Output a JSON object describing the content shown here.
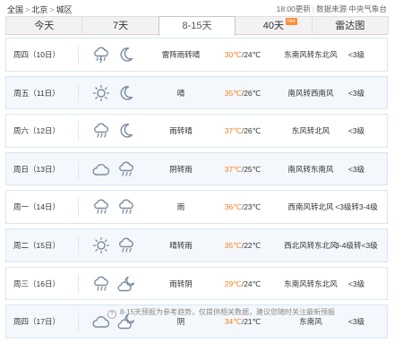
{
  "breadcrumb": [
    "全国",
    "北京",
    "城区"
  ],
  "source": {
    "updated": "18:00更新",
    "label": "数据来源 中央气象台"
  },
  "tabs": [
    {
      "label": "今天",
      "active": false
    },
    {
      "label": "7天",
      "active": false
    },
    {
      "label": "8-15天",
      "active": true
    },
    {
      "label": "40天",
      "active": false,
      "badge": "Hot"
    },
    {
      "label": "雷达图",
      "active": false
    }
  ],
  "rows": [
    {
      "date": "周四（10日）",
      "icons": [
        "thunderstorm-icon",
        "moon-icon"
      ],
      "weather": "雷阵雨转晴",
      "high": "30℃",
      "low": "24℃",
      "wind": "东南风转东北风",
      "level": "<3级"
    },
    {
      "date": "周五（11日）",
      "icons": [
        "sun-icon",
        "moon-icon"
      ],
      "weather": "晴",
      "high": "35℃",
      "low": "26℃",
      "wind": "南风转西南风",
      "level": "<3级"
    },
    {
      "date": "周六（12日）",
      "icons": [
        "rain-icon",
        "moon-icon"
      ],
      "weather": "雨转晴",
      "high": "37℃",
      "low": "26℃",
      "wind": "东风转北风",
      "level": "<3级"
    },
    {
      "date": "周日（13日）",
      "icons": [
        "cloudy-icon",
        "rain-icon"
      ],
      "weather": "阴转雨",
      "high": "37℃",
      "low": "25℃",
      "wind": "南风转东南风",
      "level": "<3级"
    },
    {
      "date": "周一（14日）",
      "icons": [
        "rain-icon",
        "rain-icon"
      ],
      "weather": "雨",
      "high": "36℃",
      "low": "23℃",
      "wind": "西南风转北风",
      "level": "<3级转3-4级"
    },
    {
      "date": "周二（15日）",
      "icons": [
        "sun-icon",
        "rain-icon"
      ],
      "weather": "晴转雨",
      "high": "35℃",
      "low": "22℃",
      "wind": "西北风转东北风",
      "level": "3-4级转<3级"
    },
    {
      "date": "周三（16日）",
      "icons": [
        "rain-icon",
        "partly-cloudy-night-icon"
      ],
      "weather": "雨转阴",
      "high": "29℃",
      "low": "24℃",
      "wind": "东南风转东北风",
      "level": "<3级"
    },
    {
      "date": "周四（17日）",
      "icons": [
        "cloudy-icon",
        "partly-cloudy-night-icon"
      ],
      "weather": "阴",
      "high": "34℃",
      "low": "21℃",
      "wind": "东南风",
      "level": "<3级"
    }
  ],
  "footer": "8-15天预报为参考趋势，仅提供相关数据，建议您随时关注最新预报"
}
